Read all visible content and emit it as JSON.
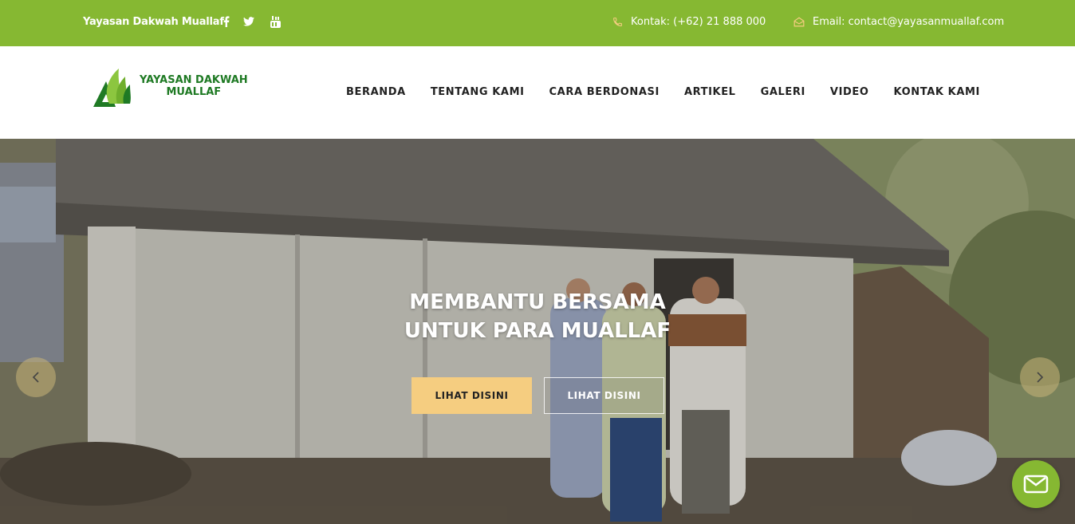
{
  "topbar": {
    "org_name": "Yayasan Dakwah Muallaf",
    "social_icons": [
      "facebook-icon",
      "twitter-icon",
      "youtube-icon"
    ],
    "phone_label": "Kontak: (+62) 21 888 000",
    "email_label": "Email: contact@yayasanmuallaf.com",
    "bg_color": "#86b832"
  },
  "header": {
    "logo_line1": "YAYASAN DAKWAH",
    "logo_line2": "MUALLAF",
    "nav": [
      "BERANDA",
      "TENTANG KAMI",
      "CARA BERDONASI",
      "ARTIKEL",
      "GALERI",
      "VIDEO",
      "KONTAK KAMI"
    ]
  },
  "hero": {
    "title_line1": "MEMBANTU BERSAMA",
    "title_line2": "UNTUK PARA MUALLAF",
    "primary_button": "LIHAT DISINI",
    "secondary_button": "LIHAT DISINI",
    "accent_color": "#f5cd80"
  }
}
